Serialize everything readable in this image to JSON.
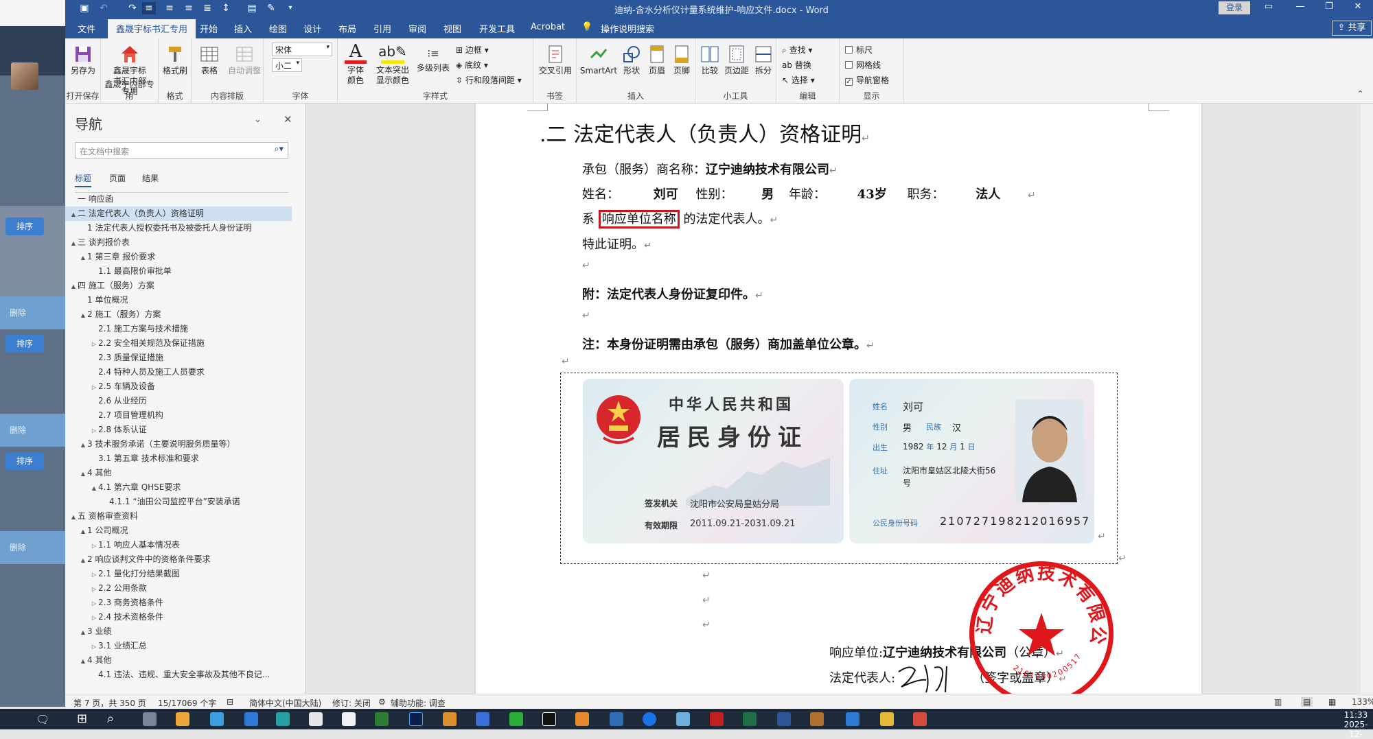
{
  "window": {
    "doc_title": "迪纳-含水分析仪计量系统维护-响应文件.docx - Word",
    "login": "登录",
    "share": "共享"
  },
  "quick_access": [
    "save-icon",
    "undo-icon",
    "redo-icon",
    "align-left-icon",
    "align-center-icon",
    "align-right-icon",
    "justify-icon",
    "line-spacing-icon",
    "print-preview-icon",
    "format-painter-icon"
  ],
  "tabs": {
    "file": "文件",
    "active": "鑫晟宇标书汇专用",
    "items": [
      "开始",
      "插入",
      "绘图",
      "设计",
      "布局",
      "引用",
      "审阅",
      "视图",
      "开发工具",
      "Acrobat"
    ],
    "tell_me": "操作说明搜索"
  },
  "ribbon": {
    "save_as": "另存为",
    "open_save": "打开保存",
    "xsy_btn": "鑫晟宇标书汇内部专用",
    "xsy_group": "鑫晟宇内部专用",
    "format_brush": "格式刷",
    "format_group": "格式",
    "table": "表格",
    "auto_adjust": "自动调整",
    "content_group": "内容排版",
    "font_name": "宋体",
    "font_size": "小二",
    "font_group": "字体",
    "font_color": "字体颜色",
    "highlight": "文本突出显示颜色",
    "multilevel": "多级列表",
    "border": "边框",
    "shading": "底纹",
    "para_spacing": "行和段落间距",
    "style_group": "字样式",
    "crossref": "交叉引用",
    "bookmark_group": "书签",
    "smartart": "SmartArt",
    "shape": "形状",
    "header": "页眉",
    "footer": "页脚",
    "insert_group": "插入",
    "compare": "比较",
    "margin": "页边距",
    "split": "拆分",
    "tools_group": "小工具",
    "find": "查找",
    "replace": "替换",
    "select": "选择",
    "edit_group": "编辑",
    "ruler": "标尺",
    "grid": "网格线",
    "navpane": "导航窗格",
    "show_group": "显示"
  },
  "nav": {
    "title": "导航",
    "search_placeholder": "在文档中搜索",
    "tabs": [
      "标题",
      "页面",
      "结果"
    ],
    "items": [
      {
        "text": "一 响应函",
        "lvl": 0,
        "tri": ""
      },
      {
        "text": "二 法定代表人（负责人）资格证明",
        "lvl": 0,
        "tri": "▲",
        "sel": true
      },
      {
        "text": "1 法定代表人授权委托书及被委托人身份证明",
        "lvl": 1,
        "tri": ""
      },
      {
        "text": "三 谈判报价表",
        "lvl": 0,
        "tri": "▲"
      },
      {
        "text": "1 第三章 报价要求",
        "lvl": 1,
        "tri": "▲"
      },
      {
        "text": "1.1 最高限价审批单",
        "lvl": 2,
        "tri": ""
      },
      {
        "text": "四 施工（服务）方案",
        "lvl": 0,
        "tri": "▲"
      },
      {
        "text": "1 单位概况",
        "lvl": 1,
        "tri": ""
      },
      {
        "text": "2 施工（服务）方案",
        "lvl": 1,
        "tri": "▲"
      },
      {
        "text": "2.1 施工方案与技术措施",
        "lvl": 2,
        "tri": ""
      },
      {
        "text": "2.2 安全相关规范及保证措施",
        "lvl": 2,
        "tri": "▷"
      },
      {
        "text": "2.3 质量保证措施",
        "lvl": 2,
        "tri": ""
      },
      {
        "text": "2.4 特种人员及施工人员要求",
        "lvl": 2,
        "tri": ""
      },
      {
        "text": "2.5 车辆及设备",
        "lvl": 2,
        "tri": "▷"
      },
      {
        "text": "2.6 从业经历",
        "lvl": 2,
        "tri": ""
      },
      {
        "text": "2.7 项目管理机构",
        "lvl": 2,
        "tri": ""
      },
      {
        "text": "2.8 体系认证",
        "lvl": 2,
        "tri": "▷"
      },
      {
        "text": "3 技术服务承诺（主要说明服务质量等）",
        "lvl": 1,
        "tri": "▲"
      },
      {
        "text": "3.1 第五章 技术标准和要求",
        "lvl": 2,
        "tri": ""
      },
      {
        "text": "4 其他",
        "lvl": 1,
        "tri": "▲"
      },
      {
        "text": "4.1 第六章 QHSE要求",
        "lvl": 2,
        "tri": "▲"
      },
      {
        "text": "4.1.1 “油田公司监控平台”安装承诺",
        "lvl": 3,
        "tri": ""
      },
      {
        "text": "五 资格审查资料",
        "lvl": 0,
        "tri": "▲"
      },
      {
        "text": "1 公司概况",
        "lvl": 1,
        "tri": "▲"
      },
      {
        "text": "1.1 响应人基本情况表",
        "lvl": 2,
        "tri": "▷"
      },
      {
        "text": "2 响应谈判文件中的资格条件要求",
        "lvl": 1,
        "tri": "▲"
      },
      {
        "text": "2.1 量化打分结果截图",
        "lvl": 2,
        "tri": "▷"
      },
      {
        "text": "2.2 公用条款",
        "lvl": 2,
        "tri": "▷"
      },
      {
        "text": "2.3 商务资格条件",
        "lvl": 2,
        "tri": "▷"
      },
      {
        "text": "2.4 技术资格条件",
        "lvl": 2,
        "tri": "▷"
      },
      {
        "text": "3 业绩",
        "lvl": 1,
        "tri": "▲"
      },
      {
        "text": "3.1 业绩汇总",
        "lvl": 2,
        "tri": "▷"
      },
      {
        "text": "4 其他",
        "lvl": 1,
        "tri": "▲"
      },
      {
        "text": "4.1 违法、违规、重大安全事故及其他不良记...",
        "lvl": 2,
        "tri": ""
      }
    ]
  },
  "doc": {
    "heading": ".二 法定代表人（负责人）资格证明",
    "line1_label": "承包（服务）商名称：",
    "line1_value": "辽宁迪纳技术有限公司",
    "name_label": "姓名：",
    "name_value": "刘可",
    "gender_label": "性别：",
    "gender_value": "男",
    "age_label": "年龄：",
    "age_value": "43岁",
    "title_label": "职务：",
    "title_value": "法人",
    "line3_pre": "系",
    "line3_box": "响应单位名称",
    "line3_post": "的法定代表人。",
    "line4": "特此证明。",
    "attach": "附：法定代表人身份证复印件。",
    "note": "注：本身份证明需由承包（服务）商加盖单位公章。",
    "resp_label": "响应单位:",
    "resp_value": "辽宁迪纳技术有限公司",
    "resp_seal": "（公章）",
    "legal_label": "法定代表人:",
    "legal_sign": "（签字或盖章）"
  },
  "idcard": {
    "country": "中华人民共和国",
    "card_title": "居民身份证",
    "issuer_label": "签发机关",
    "issuer": "沈阳市公安局皇姑分局",
    "valid_label": "有效期限",
    "valid": "2011.09.21-2031.09.21",
    "name_label": "姓名",
    "name": "刘可",
    "sex_label": "性别",
    "sex": "男",
    "nation_label": "民族",
    "nation": "汉",
    "birth_label": "出生",
    "birth_y": "1982",
    "birth_m": "12",
    "birth_d": "1",
    "year": "年",
    "month": "月",
    "day": "日",
    "addr_label": "住址",
    "addr1": "沈阳市皇姑区北陵大街56",
    "addr2": "号",
    "id_label": "公民身份号码",
    "id_no": "210727198212016957"
  },
  "stamp": {
    "text": "辽宁迪纳技术有限公司",
    "code": "2101050200517"
  },
  "status": {
    "page": "第 7 页，共 350 页",
    "words": "15/17069 个字",
    "lang": "简体中文(中国大陆)",
    "track": "修订: 关闭",
    "access": "辅助功能: 调查",
    "zoom": "133%"
  },
  "bg": {
    "sort": "排序",
    "del": "删除"
  },
  "clock": {
    "time": "11:33",
    "date": "2025-12-"
  }
}
